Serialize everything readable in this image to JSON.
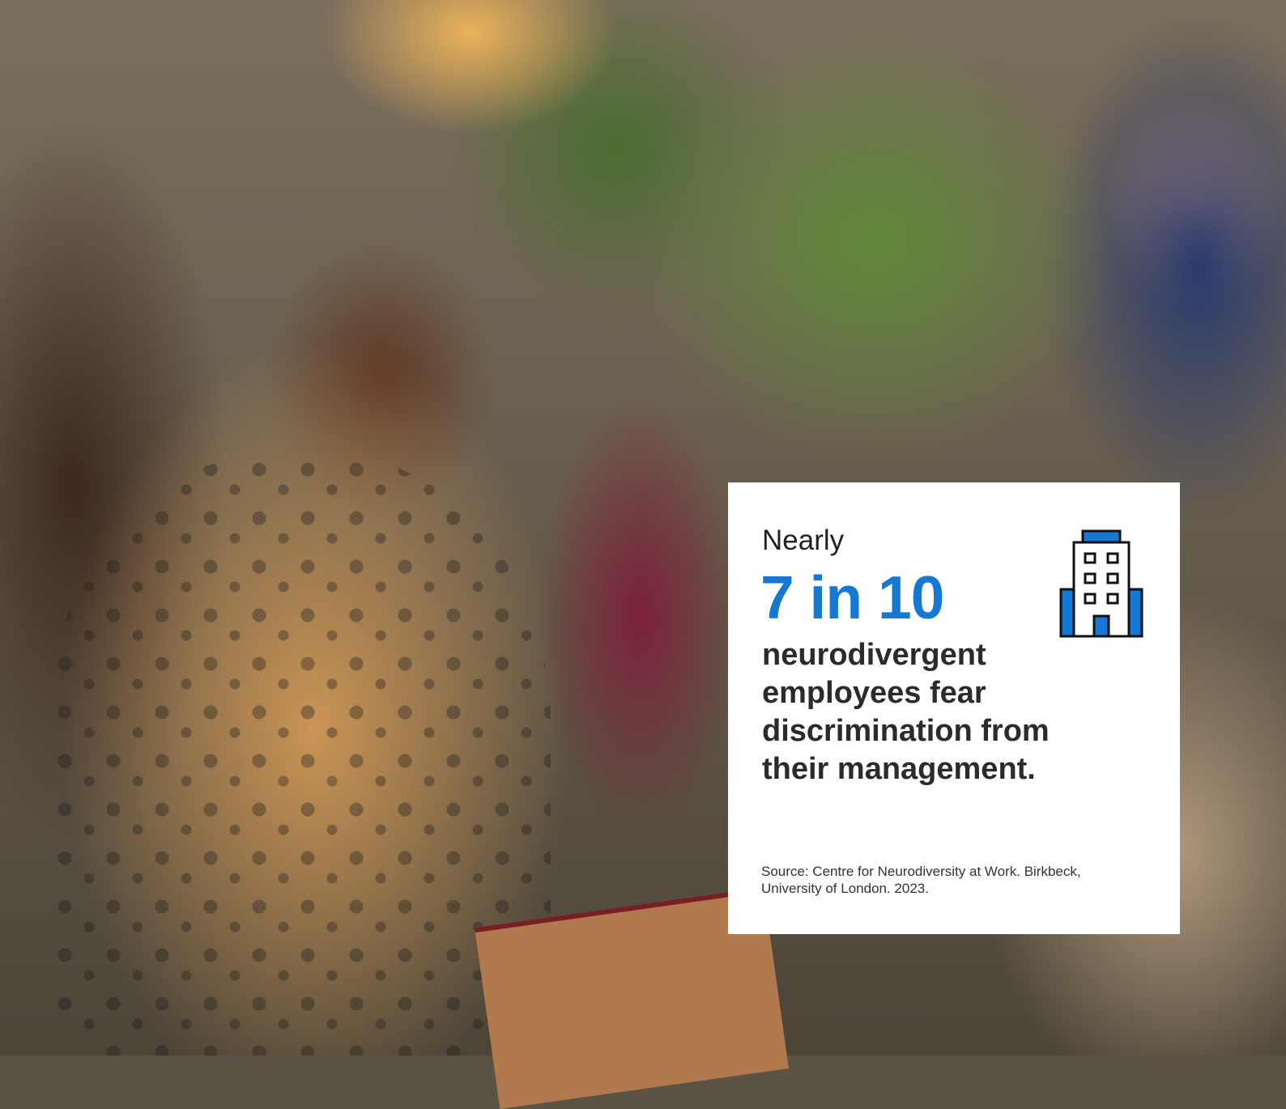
{
  "image": {
    "description_icon": "office-building-icon"
  },
  "card": {
    "kicker": "Nearly",
    "stat": "7 in 10",
    "statement": "neurodivergent employees fear discrimination from their management.",
    "source_line1": "Source: Centre for Neurodiversity at Work. Birkbeck,",
    "source_line2": "University of London. 2023.",
    "accent_color": "#1478d4"
  }
}
